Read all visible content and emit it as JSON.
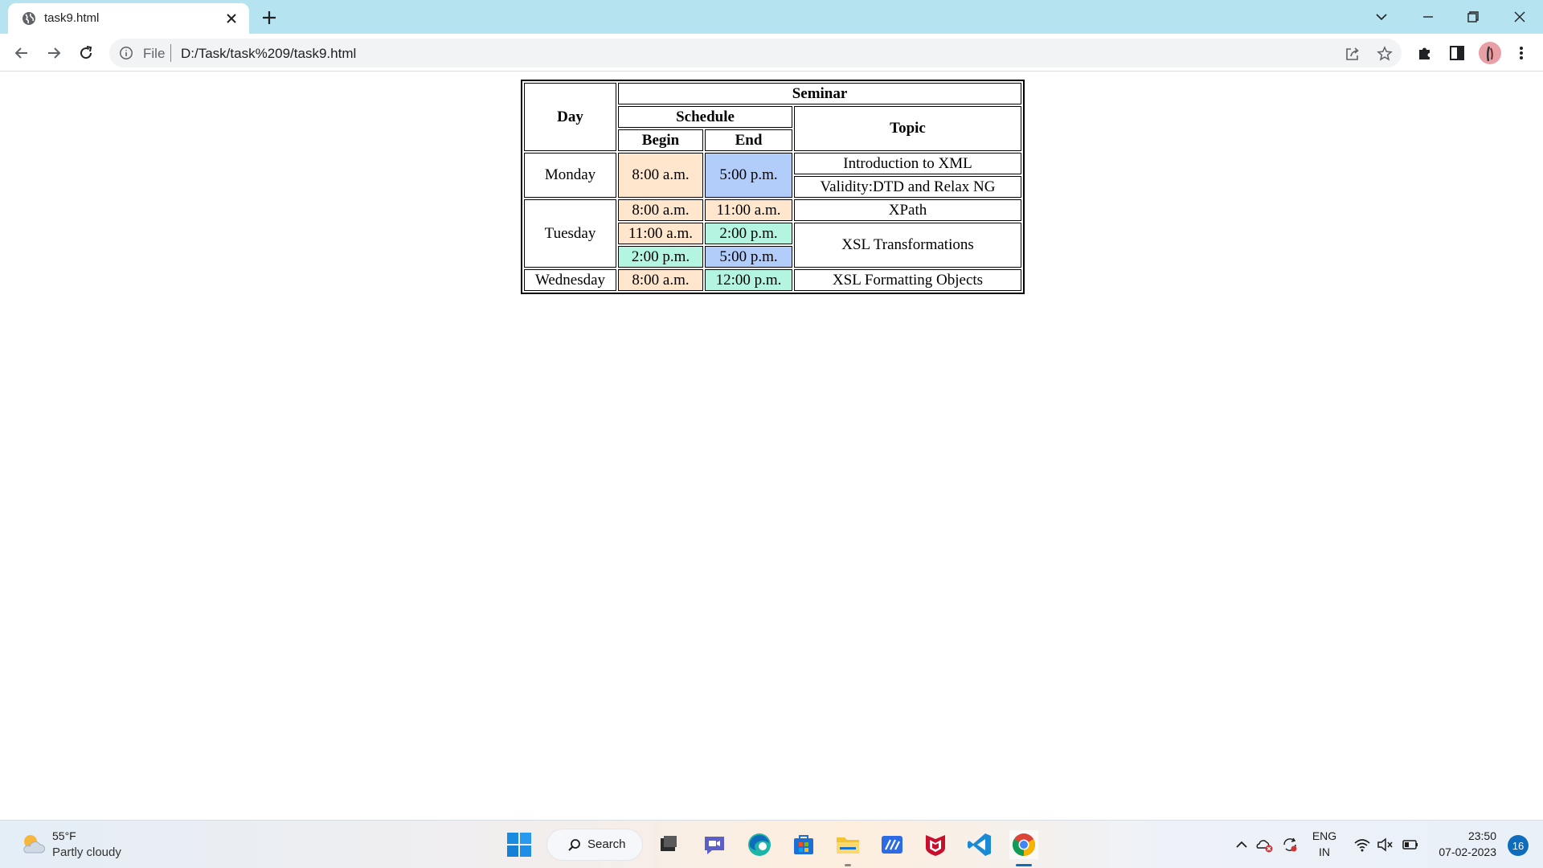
{
  "browser": {
    "tab_title": "task9.html",
    "address_scheme": "File",
    "address_url": "D:/Task/task%209/task9.html"
  },
  "table": {
    "header_seminar": "Seminar",
    "header_day": "Day",
    "header_schedule": "Schedule",
    "header_topic": "Topic",
    "header_begin": "Begin",
    "header_end": "End",
    "rows": {
      "monday": {
        "day": "Monday",
        "begin": "8:00 a.m.",
        "end": "5:00 p.m.",
        "topic_1": "Introduction to XML",
        "topic_2": "Validity:DTD and Relax NG"
      },
      "tuesday": {
        "day": "Tuesday",
        "s1_begin": "8:00 a.m.",
        "s1_end": "11:00 a.m.",
        "s1_topic": "XPath",
        "s2_begin": "11:00 a.m.",
        "s2_end": "2:00 p.m.",
        "s2_topic": "XSL Transformations",
        "s3_begin": "2:00 p.m.",
        "s3_end": "5:00 p.m."
      },
      "wednesday": {
        "day": "Wednesday",
        "begin": "8:00 a.m.",
        "end": "12:00 p.m.",
        "topic": "XSL Formatting Objects"
      }
    },
    "colors": {
      "begin_cell": "#ffe6cc",
      "end_blue_cell": "#b3cdfb",
      "green_cell": "#b3f5e1"
    }
  },
  "taskbar": {
    "weather_temp": "55°F",
    "weather_desc": "Partly cloudy",
    "search_label": "Search",
    "lang_line1": "ENG",
    "lang_line2": "IN",
    "time": "23:50",
    "date": "07-02-2023",
    "notification_count": "16"
  }
}
